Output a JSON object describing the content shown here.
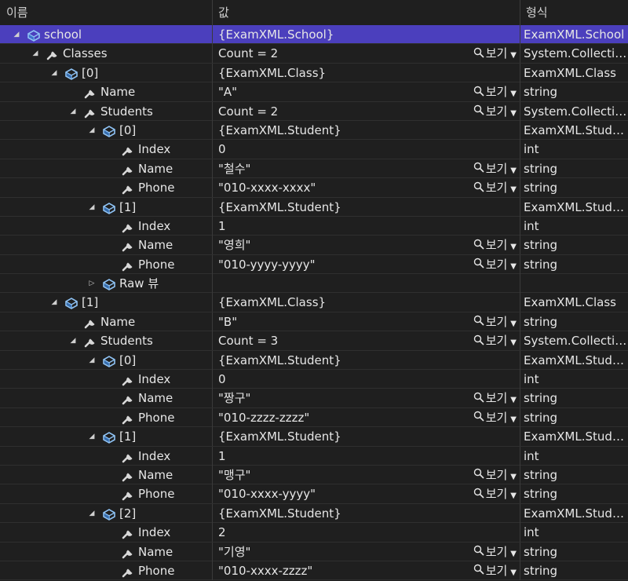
{
  "header": {
    "name": "이름",
    "value": "값",
    "type": "형식"
  },
  "view_label": "보기",
  "rows": [
    {
      "depth": 0,
      "exp": "open",
      "icon": "object",
      "name": "school",
      "value": "{ExamXML.School}",
      "type": "ExamXML.School",
      "view": false,
      "selected": true
    },
    {
      "depth": 1,
      "exp": "open",
      "icon": "wrench",
      "name": "Classes",
      "value": "Count = 2",
      "type": "System.Collections.Generic.List",
      "view": true
    },
    {
      "depth": 2,
      "exp": "open",
      "icon": "object",
      "name": "[0]",
      "value": "{ExamXML.Class}",
      "type": "ExamXML.Class",
      "view": false
    },
    {
      "depth": 3,
      "exp": "none",
      "icon": "wrench",
      "name": "Name",
      "value": "\"A\"",
      "type": "string",
      "view": true
    },
    {
      "depth": 3,
      "exp": "open",
      "icon": "wrench",
      "name": "Students",
      "value": "Count = 2",
      "type": "System.Collections.Generic.List",
      "view": true
    },
    {
      "depth": 4,
      "exp": "open",
      "icon": "object",
      "name": "[0]",
      "value": "{ExamXML.Student}",
      "type": "ExamXML.Student",
      "view": false
    },
    {
      "depth": 5,
      "exp": "none",
      "icon": "wrench",
      "name": "Index",
      "value": "0",
      "type": "int",
      "view": false
    },
    {
      "depth": 5,
      "exp": "none",
      "icon": "wrench",
      "name": "Name",
      "value": "\"철수\"",
      "type": "string",
      "view": true
    },
    {
      "depth": 5,
      "exp": "none",
      "icon": "wrench",
      "name": "Phone",
      "value": "\"010-xxxx-xxxx\"",
      "type": "string",
      "view": true
    },
    {
      "depth": 4,
      "exp": "open",
      "icon": "object",
      "name": "[1]",
      "value": "{ExamXML.Student}",
      "type": "ExamXML.Student",
      "view": false
    },
    {
      "depth": 5,
      "exp": "none",
      "icon": "wrench",
      "name": "Index",
      "value": "1",
      "type": "int",
      "view": false
    },
    {
      "depth": 5,
      "exp": "none",
      "icon": "wrench",
      "name": "Name",
      "value": "\"영희\"",
      "type": "string",
      "view": true
    },
    {
      "depth": 5,
      "exp": "none",
      "icon": "wrench",
      "name": "Phone",
      "value": "\"010-yyyy-yyyy\"",
      "type": "string",
      "view": true
    },
    {
      "depth": 4,
      "exp": "closed",
      "icon": "object",
      "name": "Raw 뷰",
      "value": "",
      "type": "",
      "view": false
    },
    {
      "depth": 2,
      "exp": "open",
      "icon": "object",
      "name": "[1]",
      "value": "{ExamXML.Class}",
      "type": "ExamXML.Class",
      "view": false
    },
    {
      "depth": 3,
      "exp": "none",
      "icon": "wrench",
      "name": "Name",
      "value": "\"B\"",
      "type": "string",
      "view": true
    },
    {
      "depth": 3,
      "exp": "open",
      "icon": "wrench",
      "name": "Students",
      "value": "Count = 3",
      "type": "System.Collections.Generic.List",
      "view": true
    },
    {
      "depth": 4,
      "exp": "open",
      "icon": "object",
      "name": "[0]",
      "value": "{ExamXML.Student}",
      "type": "ExamXML.Student",
      "view": false
    },
    {
      "depth": 5,
      "exp": "none",
      "icon": "wrench",
      "name": "Index",
      "value": "0",
      "type": "int",
      "view": false
    },
    {
      "depth": 5,
      "exp": "none",
      "icon": "wrench",
      "name": "Name",
      "value": "\"짱구\"",
      "type": "string",
      "view": true
    },
    {
      "depth": 5,
      "exp": "none",
      "icon": "wrench",
      "name": "Phone",
      "value": "\"010-zzzz-zzzz\"",
      "type": "string",
      "view": true
    },
    {
      "depth": 4,
      "exp": "open",
      "icon": "object",
      "name": "[1]",
      "value": "{ExamXML.Student}",
      "type": "ExamXML.Student",
      "view": false
    },
    {
      "depth": 5,
      "exp": "none",
      "icon": "wrench",
      "name": "Index",
      "value": "1",
      "type": "int",
      "view": false
    },
    {
      "depth": 5,
      "exp": "none",
      "icon": "wrench",
      "name": "Name",
      "value": "\"맹구\"",
      "type": "string",
      "view": true
    },
    {
      "depth": 5,
      "exp": "none",
      "icon": "wrench",
      "name": "Phone",
      "value": "\"010-xxxx-yyyy\"",
      "type": "string",
      "view": true
    },
    {
      "depth": 4,
      "exp": "open",
      "icon": "object",
      "name": "[2]",
      "value": "{ExamXML.Student}",
      "type": "ExamXML.Student",
      "view": false
    },
    {
      "depth": 5,
      "exp": "none",
      "icon": "wrench",
      "name": "Index",
      "value": "2",
      "type": "int",
      "view": false
    },
    {
      "depth": 5,
      "exp": "none",
      "icon": "wrench",
      "name": "Name",
      "value": "\"기영\"",
      "type": "string",
      "view": true
    },
    {
      "depth": 5,
      "exp": "none",
      "icon": "wrench",
      "name": "Phone",
      "value": "\"010-xxxx-zzzz\"",
      "type": "string",
      "view": true
    }
  ]
}
